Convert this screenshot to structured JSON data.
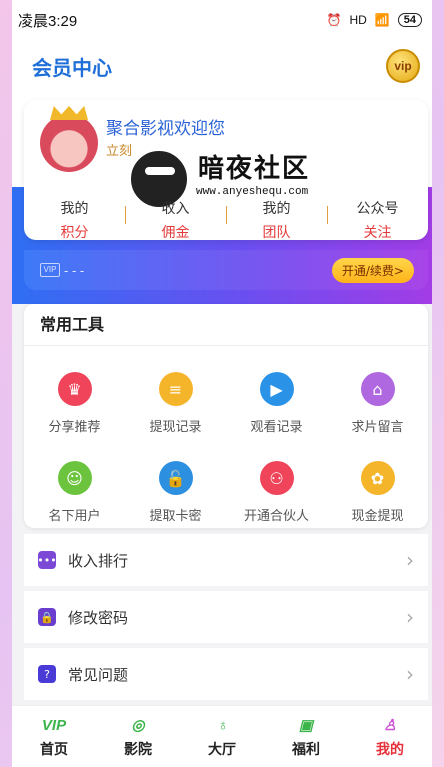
{
  "status_bar": {
    "time": "凌晨3:29",
    "signal": "HD",
    "battery": "54"
  },
  "header": {
    "title": "会员中心",
    "vip_label": "vip"
  },
  "profile": {
    "welcome": "聚合影视欢迎您",
    "sub_link": "立刻",
    "watermark_title": "暗夜社区",
    "watermark_url": "www.anyeshequ.com",
    "stats": [
      {
        "top": "我的",
        "bottom": "积分"
      },
      {
        "top": "收入",
        "bottom": "佣金"
      },
      {
        "top": "我的",
        "bottom": "团队"
      },
      {
        "top": "公众号",
        "bottom": "关注"
      }
    ]
  },
  "vip_bar": {
    "chip_label": "VIP",
    "status": "- - -",
    "button": "开通/续费>"
  },
  "tools": {
    "title": "常用工具",
    "items": [
      {
        "label": "分享推荐",
        "icon": "crown-icon",
        "color": "#f0445a",
        "glyph": "♛"
      },
      {
        "label": "提现记录",
        "icon": "coins-icon",
        "color": "#f5b52a",
        "glyph": "≡"
      },
      {
        "label": "观看记录",
        "icon": "play-icon",
        "color": "#2a93e8",
        "glyph": "▶"
      },
      {
        "label": "求片留言",
        "icon": "store-icon",
        "color": "#b068e0",
        "glyph": "⌂"
      },
      {
        "label": "名下用户",
        "icon": "user-card-icon",
        "color": "#6cc43e",
        "glyph": "☺"
      },
      {
        "label": "提取卡密",
        "icon": "unlock-icon",
        "color": "#2d8fe0",
        "glyph": "🔓"
      },
      {
        "label": "开通合伙人",
        "icon": "network-icon",
        "color": "#f0445a",
        "glyph": "⚇"
      },
      {
        "label": "现金提现",
        "icon": "gear-coin-icon",
        "color": "#f5b52a",
        "glyph": "✿"
      }
    ]
  },
  "menu": [
    {
      "label": "收入排行",
      "icon": "chat-dots-icon",
      "color": "#7b49d6",
      "glyph": "•••"
    },
    {
      "label": "修改密码",
      "icon": "lock-icon",
      "color": "#6a3fd0",
      "glyph": "🔒"
    },
    {
      "label": "常见问题",
      "icon": "question-icon",
      "color": "#4a3ad6",
      "glyph": "?"
    }
  ],
  "tabbar": [
    {
      "label": "首页",
      "icon": "vip-home-icon",
      "glyph": "VIP",
      "active": false
    },
    {
      "label": "影院",
      "icon": "film-reel-icon",
      "glyph": "◎",
      "active": false
    },
    {
      "label": "大厅",
      "icon": "planet-icon",
      "glyph": "♁",
      "active": false
    },
    {
      "label": "福利",
      "icon": "gift-icon",
      "glyph": "▣",
      "active": false
    },
    {
      "label": "我的",
      "icon": "user-icon",
      "glyph": "♙",
      "active": true
    }
  ]
}
